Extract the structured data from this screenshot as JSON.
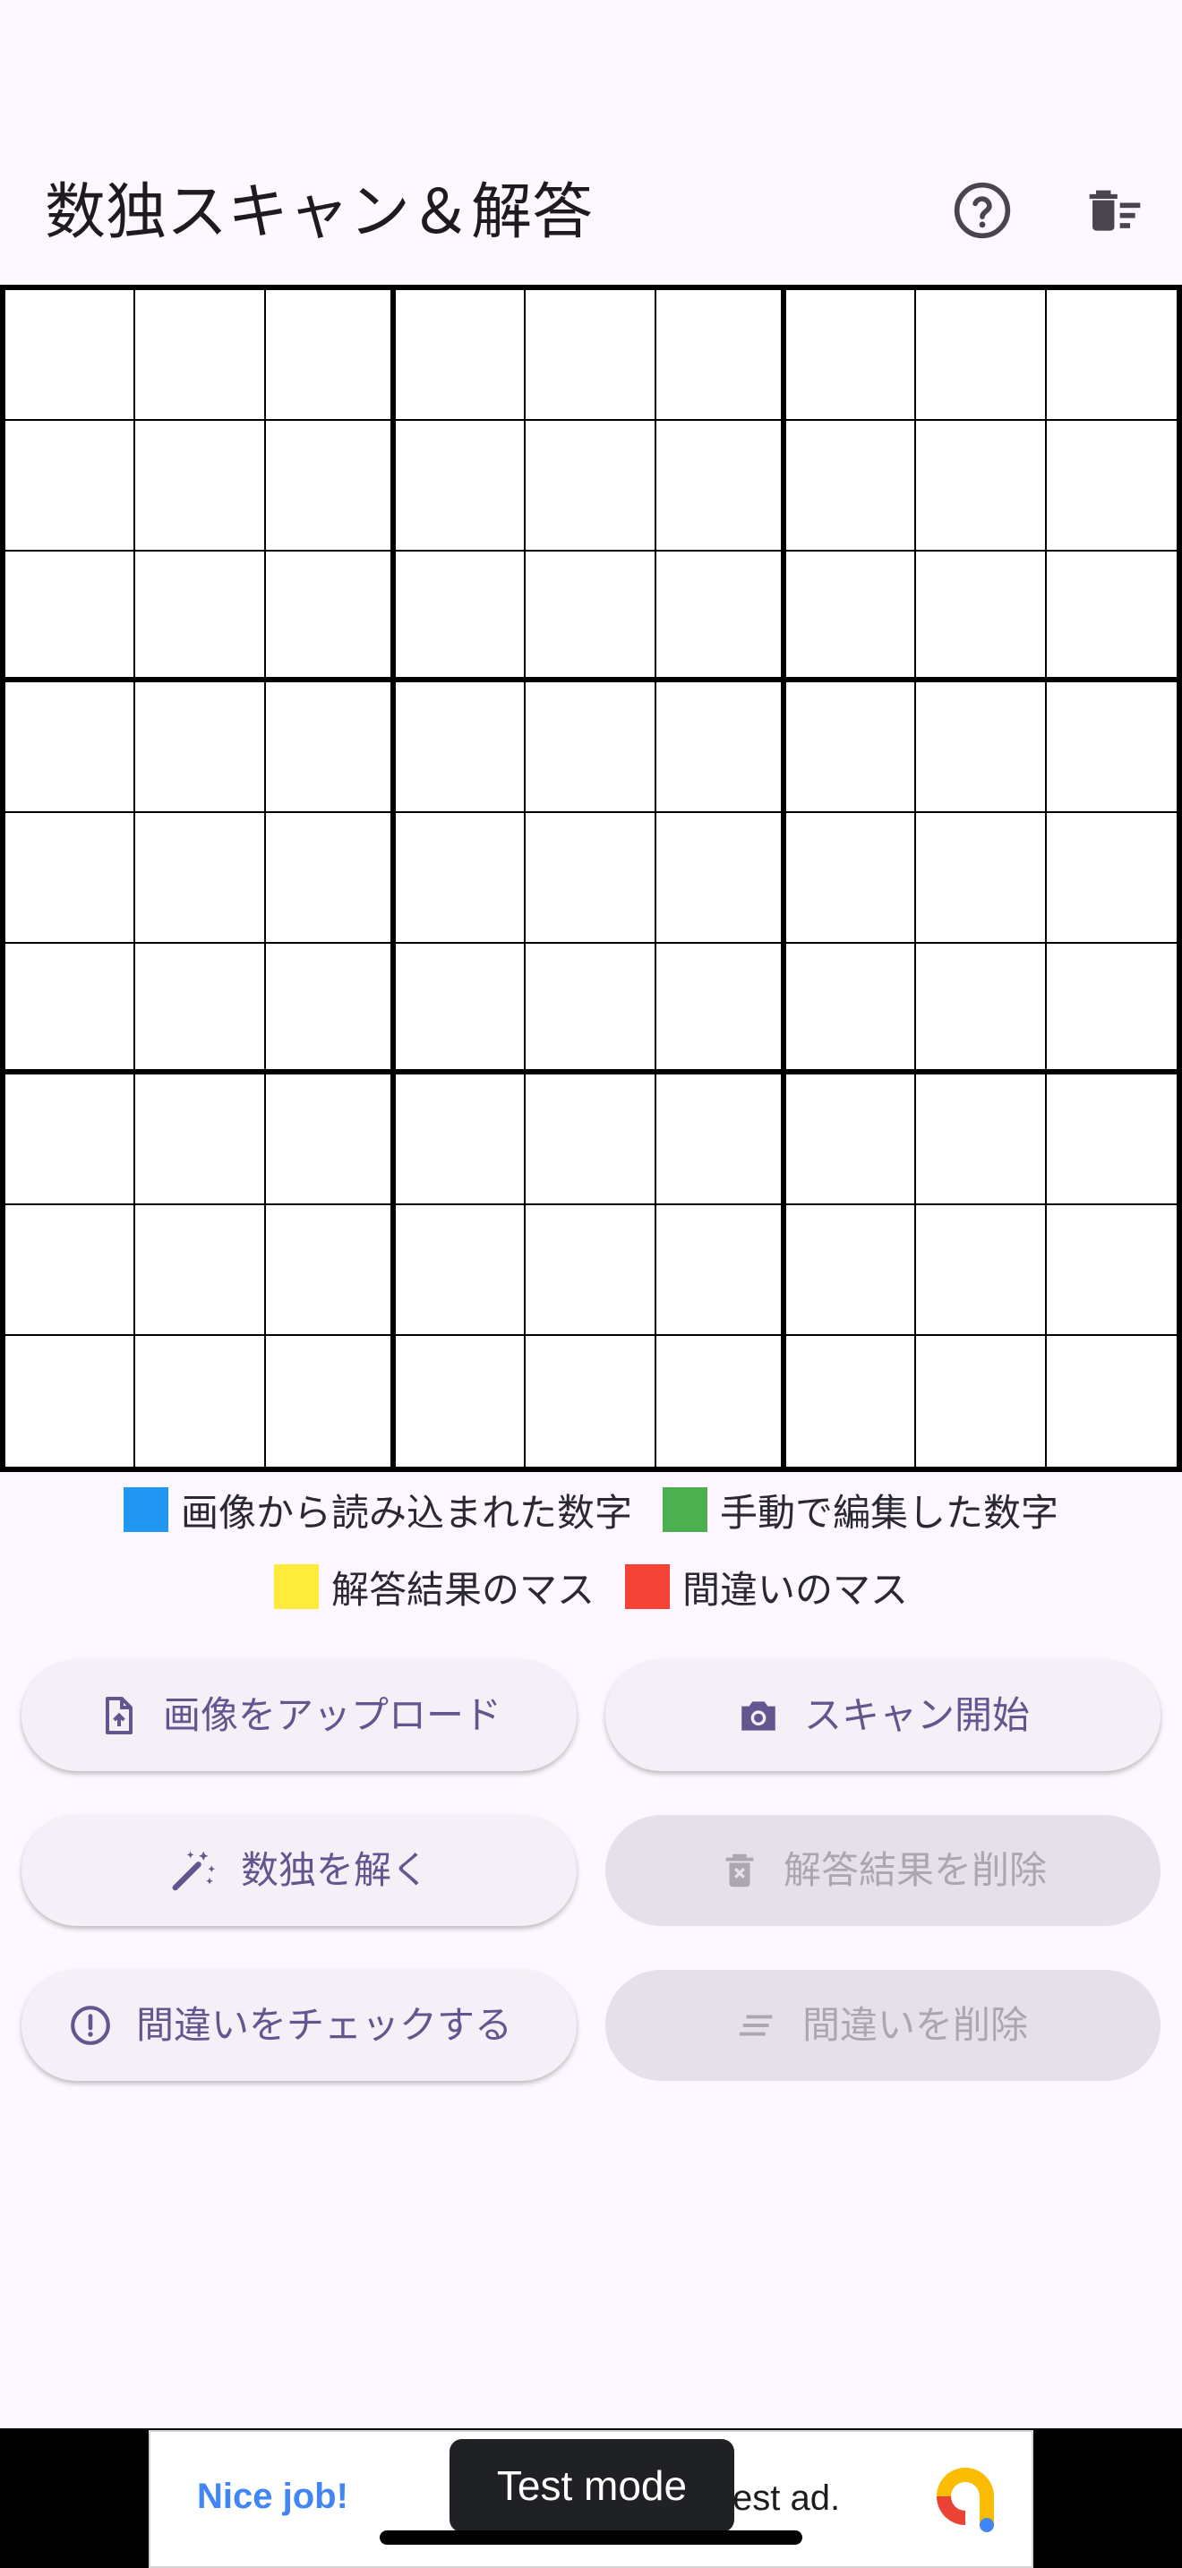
{
  "app_bar": {
    "title": "数独スキャン＆解答",
    "help_icon": "help-circle-icon",
    "clear_icon": "delete-sweep-icon"
  },
  "board": {
    "rows": 9,
    "cols": 9,
    "values": []
  },
  "legend": [
    {
      "color": "#2196f3",
      "label": "画像から読み込まれた数字"
    },
    {
      "color": "#4caf50",
      "label": "手動で編集した数字"
    },
    {
      "color": "#ffeb3b",
      "label": "解答結果のマス"
    },
    {
      "color": "#f44336",
      "label": "間違いのマス"
    }
  ],
  "buttons": {
    "upload": {
      "label": "画像をアップロード",
      "icon": "upload-file-icon"
    },
    "scan": {
      "label": "スキャン開始",
      "icon": "camera-icon"
    },
    "solve": {
      "label": "数独を解く",
      "icon": "magic-wand-icon"
    },
    "clear_solution": {
      "label": "解答結果を削除",
      "icon": "delete-forever-icon"
    },
    "check": {
      "label": "間違いをチェックする",
      "icon": "error-outline-icon"
    },
    "clear_errors": {
      "label": "間違いを削除",
      "icon": "clear-all-icon"
    }
  },
  "ad": {
    "headline": "Nice job!",
    "text": "est ad.",
    "badge": "Test mode"
  },
  "colors": {
    "background": "#fdf7ff",
    "button_primary": "#65558f",
    "button_disabled": "#aca6b2"
  }
}
